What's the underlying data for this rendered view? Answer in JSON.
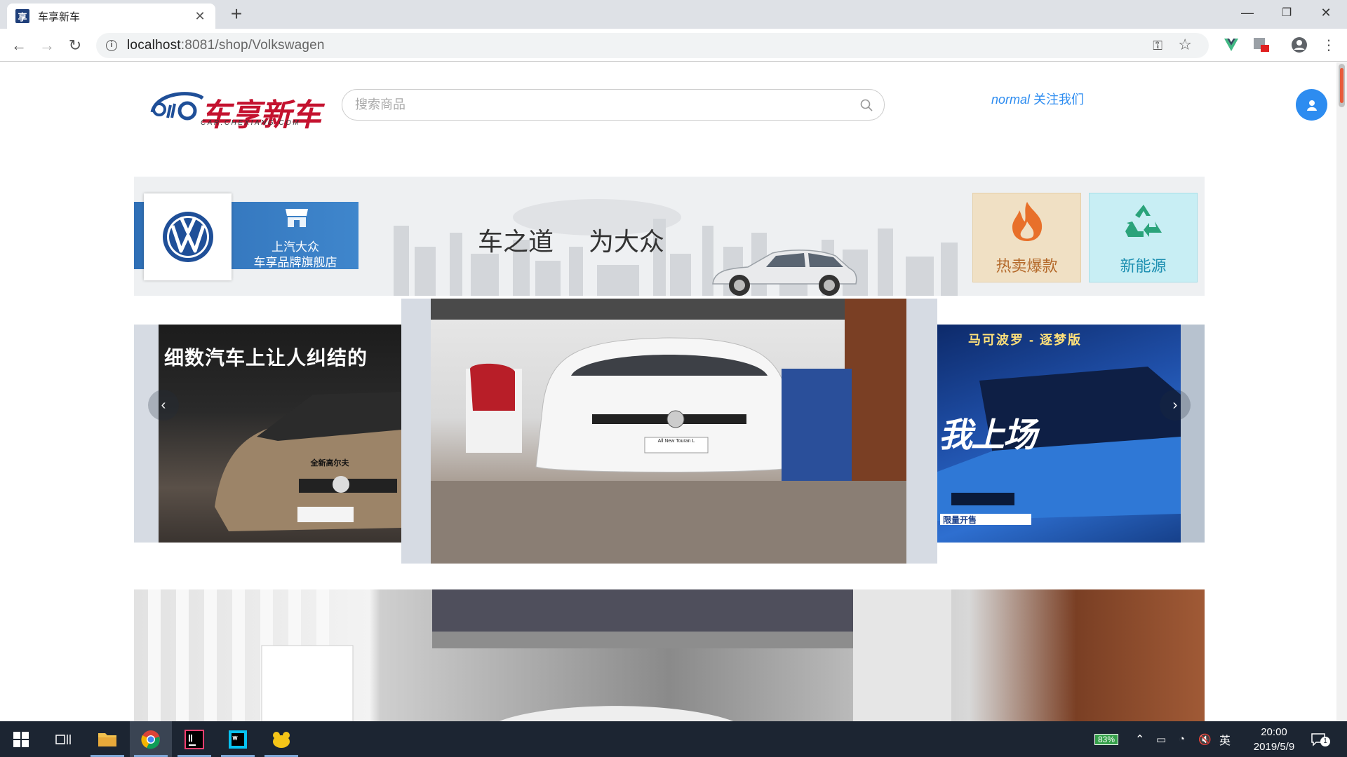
{
  "browser": {
    "tab_title": "车享新车",
    "tab_favicon": "享",
    "url_host": "localhost",
    "url_rest": ":8081/shop/Volkswagen",
    "minimize": "—",
    "maximize": "❐",
    "close": "✕"
  },
  "header": {
    "logo_cn": "车享新车",
    "logo_en": "CAR.CHEXIANG.COM",
    "search_placeholder": "搜索商品",
    "username": "normal",
    "follow_label": "关注我们"
  },
  "banner": {
    "brand_store_line1": "上汽大众",
    "brand_store_line2": "车享品牌旗舰店",
    "slogan_part1": "车之道",
    "slogan_part2": "为大众",
    "tile_hot_label": "热卖爆款",
    "tile_green_label": "新能源"
  },
  "carousel": {
    "left_caption": "细数汽车上让人纠结的",
    "left_plate": "全新高尔夫",
    "center_plate": "All New Touran L",
    "right_caption_top": "马可波罗 - 逐梦版",
    "right_caption_main": "我上场",
    "right_badge": "限量开售",
    "prev": "‹",
    "next": "›"
  },
  "taskbar": {
    "battery": "83%",
    "ime": "英",
    "time": "20:00",
    "date": "2019/5/9",
    "notifications": "1"
  },
  "colors": {
    "accent_blue": "#2d8cf0",
    "logo_red": "#c4122f",
    "vw_blue": "#1f4f98"
  }
}
